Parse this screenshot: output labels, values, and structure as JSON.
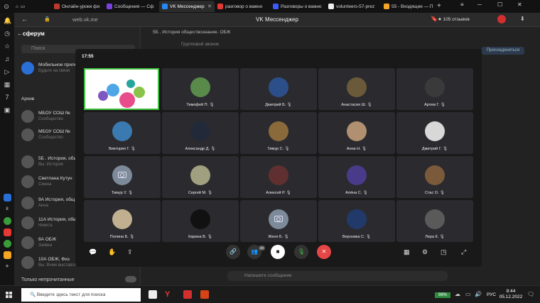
{
  "browser": {
    "tabs": [
      {
        "label": "Онлайн-уроки фи",
        "color": "#c0392b"
      },
      {
        "label": "Сообщения — Сф",
        "color": "#7b3fe4"
      },
      {
        "label": "VK Мессенджер",
        "color": "#2787f5",
        "active": true
      },
      {
        "label": "разговор о важно",
        "color": "#e53935"
      },
      {
        "label": "Разговоры о важно",
        "color": "#3d5afe"
      },
      {
        "label": "volunteers-57-prez",
        "color": "#eee"
      },
      {
        "label": "55 - Входящие — П",
        "color": "#f5a623"
      }
    ],
    "url": "web.vk.me",
    "page_title": "VK Мессенджер",
    "reviews": "105 отзывов"
  },
  "messenger": {
    "brand": "сферум",
    "search_placeholder": "Поиск",
    "top_chat": "5Б . История обществознание. ОБЖ",
    "top_chat_sub": "Групповой звонок",
    "join_label": "Присоединиться",
    "chats": [
      {
        "title": "Мобильное прило",
        "sub": "Будьте на связи"
      },
      {
        "title": "Архив",
        "sub": ""
      },
      {
        "title": "МБОУ СОШ №",
        "sub": "Сообщество"
      },
      {
        "title": "МБОУ СОШ №",
        "sub": "Сообщество"
      },
      {
        "title": "5Б . История, обществ",
        "sub": "Вы: История"
      },
      {
        "title": "Светлана Кутун",
        "sub": "Смена"
      },
      {
        "title": "9А История, общ",
        "sub": "Анна"
      },
      {
        "title": "11А История, общ",
        "sub": "Никита"
      },
      {
        "title": "8А ОБЖ",
        "sub": "Заявка"
      },
      {
        "title": "10А ОБЖ, Физ",
        "sub": "Вы: Вчем выставлять"
      }
    ],
    "only_unread": "Только непрочитанные",
    "write_placeholder": "Напишите сообщение"
  },
  "call": {
    "time": "17:55",
    "participants": [
      {
        "name": "",
        "screen": true
      },
      {
        "name": "Тимофей П.",
        "color": "#5a8a4a"
      },
      {
        "name": "Дмитрий Б.",
        "color": "#2c4f8a"
      },
      {
        "name": "Анастасия Ш.",
        "color": "#6a5a3a"
      },
      {
        "name": "Артем Г.",
        "color": "#3a3a3a"
      },
      {
        "name": "Виктория Г.",
        "color": "#3a7ab0"
      },
      {
        "name": "Александр Д.",
        "color": "#222a3a"
      },
      {
        "name": "Тимур С.",
        "color": "#8a6a3a"
      },
      {
        "name": "Анна Н.",
        "color": "#b09070"
      },
      {
        "name": "Дмитрий Г.",
        "color": "#d8d8d8"
      },
      {
        "name": "Тимур У.",
        "color": "",
        "placeholder": true
      },
      {
        "name": "Сергей М.",
        "color": "#a0a080"
      },
      {
        "name": "Алексей Р.",
        "color": "#603030"
      },
      {
        "name": "Алёна С.",
        "color": "#4a3a8a"
      },
      {
        "name": "Стас О.",
        "color": "#7a5a3a"
      },
      {
        "name": "Полина Б.",
        "color": "#c0b090"
      },
      {
        "name": "Карина В.",
        "color": "#111111"
      },
      {
        "name": "Женя Б.",
        "color": "",
        "placeholder": true
      },
      {
        "name": "Вероника С.",
        "color": "#223a6a"
      },
      {
        "name": "Лера К.",
        "color": "#5a5a5a"
      }
    ],
    "participants_count": "20"
  },
  "taskbar": {
    "search_placeholder": "Введите здесь текст для поиска",
    "battery": "98%",
    "lang": "РУС",
    "time": "8:44",
    "date": "05.12.2022"
  }
}
